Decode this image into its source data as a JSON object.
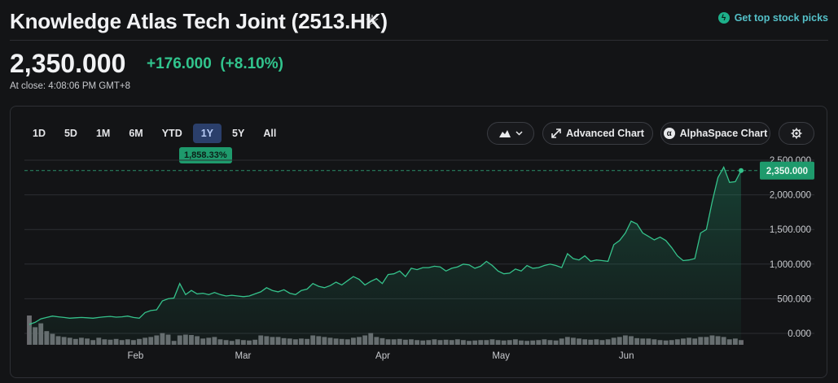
{
  "header": {
    "title": "Knowledge Atlas Tech Joint (2513.HK)",
    "top_picks_label": "Get top stock picks"
  },
  "quote": {
    "price": "2,350.000",
    "change": "+176.000  (+8.10%)",
    "close_time": "At close: 4:08:06 PM GMT+8"
  },
  "range_tabs": [
    {
      "label": "1D"
    },
    {
      "label": "5D"
    },
    {
      "label": "1M"
    },
    {
      "label": "6M"
    },
    {
      "label": "YTD"
    },
    {
      "label": "1Y",
      "active": true
    },
    {
      "label": "5Y"
    },
    {
      "label": "All"
    }
  ],
  "performance_badge": "1,858.33%",
  "controls": {
    "chart_type_icon": "mountain-chart-icon",
    "advanced_chart": "Advanced Chart",
    "alphaspace_chart": "AlphaSpace Chart",
    "settings_icon": "gear-icon"
  },
  "colors": {
    "line": "#35c28b",
    "up_text": "#31c48d",
    "volume": "#6b6c70",
    "badge": "#1e9a6c"
  },
  "chart_data": {
    "type": "area",
    "last_value_label": "2,350.000",
    "y_tick_labels": [
      "2,500.000",
      "2,000.000",
      "1,500.000",
      "1,000.000",
      "500.000",
      "0.000"
    ],
    "y_ticks": [
      2500,
      2000,
      1500,
      1000,
      500,
      0
    ],
    "ylim": [
      0,
      2500
    ],
    "x_tick_labels": [
      "Feb",
      "Mar",
      "Apr",
      "May",
      "Jun"
    ],
    "grid": true,
    "price": [
      130,
      160,
      210,
      230,
      250,
      240,
      230,
      220,
      225,
      230,
      225,
      220,
      230,
      240,
      245,
      235,
      240,
      250,
      230,
      220,
      300,
      330,
      340,
      470,
      500,
      510,
      720,
      560,
      620,
      570,
      580,
      560,
      590,
      560,
      540,
      550,
      540,
      530,
      540,
      570,
      600,
      660,
      620,
      600,
      630,
      580,
      560,
      620,
      640,
      720,
      680,
      660,
      690,
      740,
      700,
      760,
      820,
      780,
      700,
      750,
      790,
      720,
      850,
      860,
      900,
      820,
      940,
      920,
      950,
      950,
      970,
      960,
      900,
      940,
      960,
      1000,
      990,
      940,
      970,
      1040,
      980,
      900,
      860,
      870,
      930,
      900,
      980,
      940,
      950,
      980,
      1000,
      980,
      950,
      1150,
      1080,
      1060,
      1120,
      1040,
      1060,
      1050,
      1040,
      1280,
      1340,
      1450,
      1620,
      1580,
      1450,
      1400,
      1350,
      1390,
      1340,
      1240,
      1120,
      1050,
      1060,
      1080,
      1450,
      1500,
      1900,
      2250,
      2400,
      2180,
      2190,
      2350
    ],
    "volume": [
      0.75,
      0.45,
      0.55,
      0.35,
      0.28,
      0.22,
      0.2,
      0.18,
      0.15,
      0.18,
      0.16,
      0.12,
      0.18,
      0.14,
      0.13,
      0.15,
      0.12,
      0.14,
      0.12,
      0.15,
      0.18,
      0.2,
      0.24,
      0.3,
      0.26,
      0.1,
      0.24,
      0.26,
      0.25,
      0.22,
      0.16,
      0.18,
      0.2,
      0.14,
      0.12,
      0.1,
      0.14,
      0.12,
      0.11,
      0.13,
      0.24,
      0.22,
      0.2,
      0.2,
      0.17,
      0.16,
      0.14,
      0.16,
      0.15,
      0.24,
      0.22,
      0.2,
      0.18,
      0.16,
      0.15,
      0.14,
      0.18,
      0.2,
      0.24,
      0.3,
      0.2,
      0.17,
      0.14,
      0.14,
      0.15,
      0.13,
      0.14,
      0.12,
      0.11,
      0.12,
      0.14,
      0.12,
      0.13,
      0.12,
      0.14,
      0.12,
      0.1,
      0.11,
      0.12,
      0.12,
      0.14,
      0.12,
      0.11,
      0.12,
      0.14,
      0.11,
      0.1,
      0.11,
      0.12,
      0.14,
      0.12,
      0.11,
      0.16,
      0.2,
      0.18,
      0.16,
      0.14,
      0.13,
      0.14,
      0.12,
      0.14,
      0.18,
      0.2,
      0.24,
      0.22,
      0.17,
      0.16,
      0.16,
      0.14,
      0.12,
      0.11,
      0.12,
      0.14,
      0.16,
      0.18,
      0.16,
      0.2,
      0.2,
      0.24,
      0.22,
      0.2,
      0.14,
      0.16,
      0.12
    ]
  }
}
